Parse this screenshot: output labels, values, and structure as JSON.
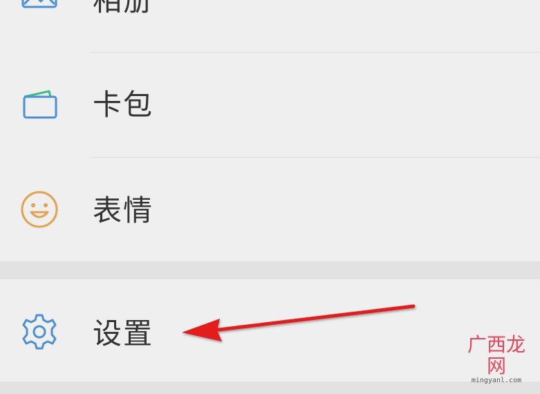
{
  "menu": {
    "items": [
      {
        "id": "album",
        "label": "相册",
        "icon": "image-icon",
        "icon_color": "#4a90d9"
      },
      {
        "id": "cards",
        "label": "卡包",
        "icon": "wallet-icon",
        "icon_color": "#4a90d9",
        "accent_color": "#3bbf7a"
      },
      {
        "id": "stickers",
        "label": "表情",
        "icon": "smiley-icon",
        "icon_color": "#e6a24a"
      },
      {
        "id": "settings",
        "label": "设置",
        "icon": "gear-icon",
        "icon_color": "#4a90d9"
      }
    ]
  },
  "annotation": {
    "type": "arrow",
    "color": "#e41b1b",
    "points_to": "settings"
  },
  "watermark": {
    "text_cn": "广西龙网",
    "text_en": "mingyanl.com"
  }
}
